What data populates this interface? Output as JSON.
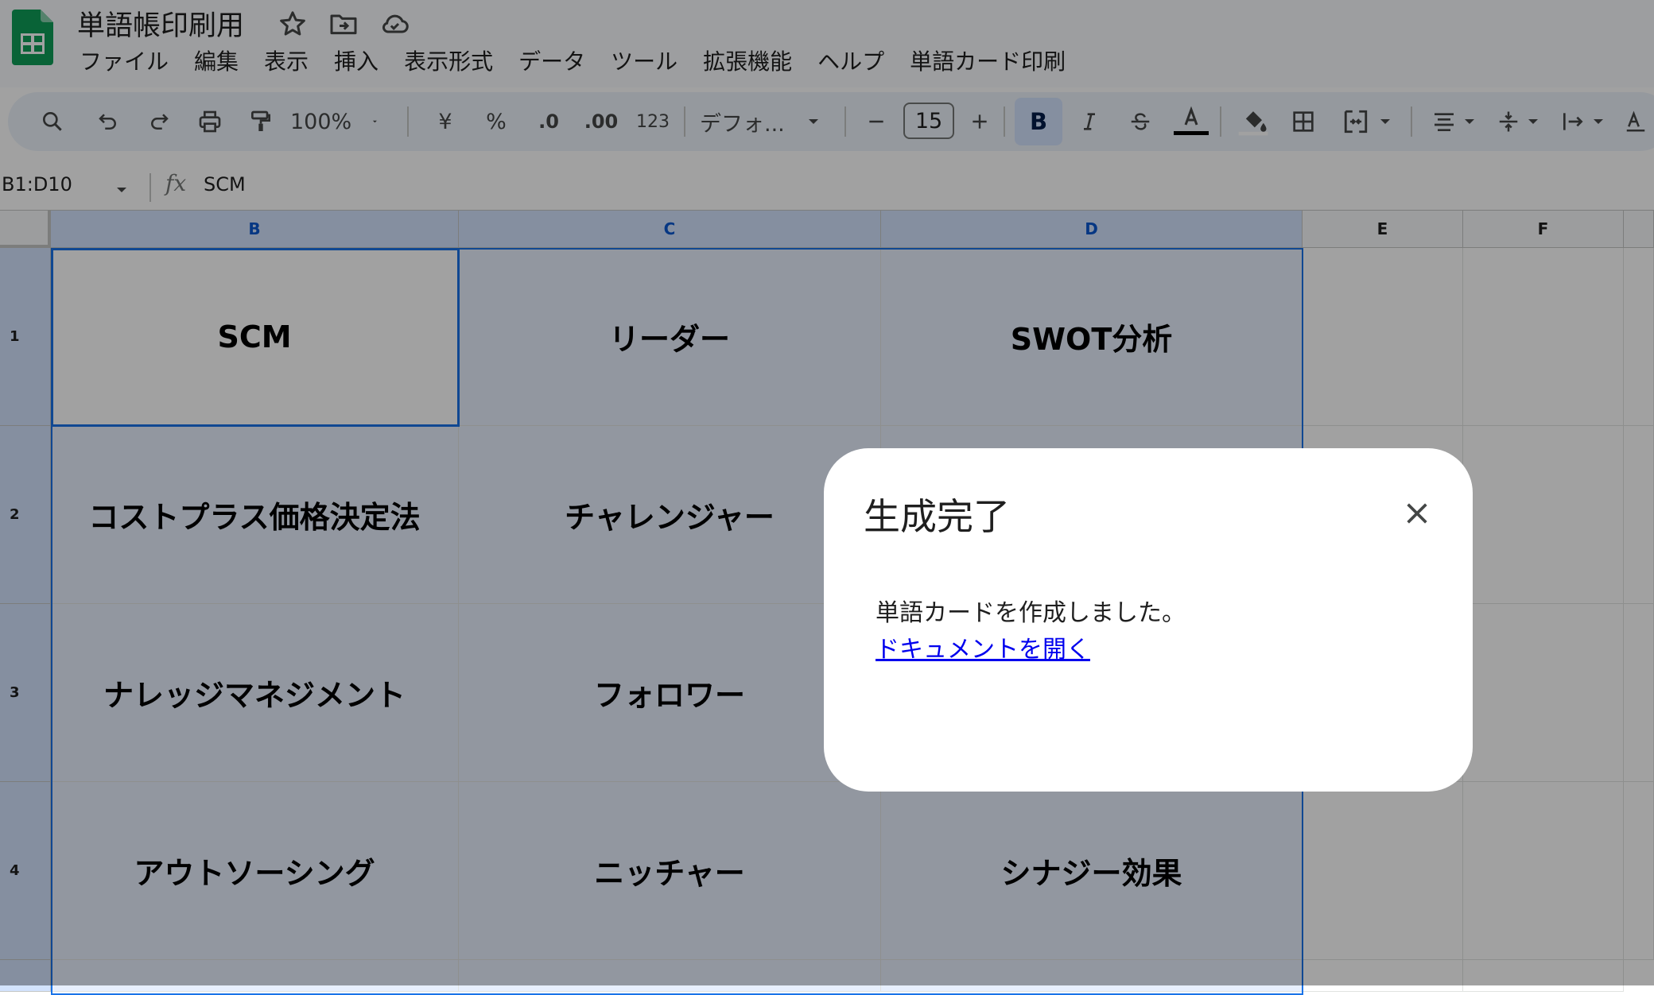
{
  "app": {
    "title": "単語帳印刷用",
    "menu": [
      "ファイル",
      "編集",
      "表示",
      "挿入",
      "表示形式",
      "データ",
      "ツール",
      "拡張機能",
      "ヘルプ",
      "単語カード印刷"
    ]
  },
  "toolbar": {
    "zoom": "100%",
    "currency": "¥",
    "percent": "%",
    "decrease_decimal": ".0",
    "increase_decimal": ".00",
    "number_format": "123",
    "font": "デフォ...",
    "font_size": "15",
    "bold": "B"
  },
  "formula_bar": {
    "name_box": "B1:D10",
    "fx": "fx",
    "value": "SCM"
  },
  "grid": {
    "columns": [
      "B",
      "C",
      "D",
      "E",
      "F"
    ],
    "rows": [
      {
        "number": "1",
        "cells": [
          "SCM",
          "リーダー",
          "SWOT分析"
        ]
      },
      {
        "number": "2",
        "cells": [
          "コストプラス価格決定法",
          "チャレンジャー",
          ""
        ]
      },
      {
        "number": "3",
        "cells": [
          "ナレッジマネジメント",
          "フォロワー",
          ""
        ]
      },
      {
        "number": "4",
        "cells": [
          "アウトソーシング",
          "ニッチャー",
          "シナジー効果"
        ]
      }
    ]
  },
  "dialog": {
    "title": "生成完了",
    "message": "単語カードを作成しました。",
    "link": "ドキュメントを開く"
  },
  "colors": {
    "accent": "#1a73e8",
    "sheets_green": "#0f9d58",
    "selection": "#d3e3fd",
    "link": "#0000ee"
  }
}
